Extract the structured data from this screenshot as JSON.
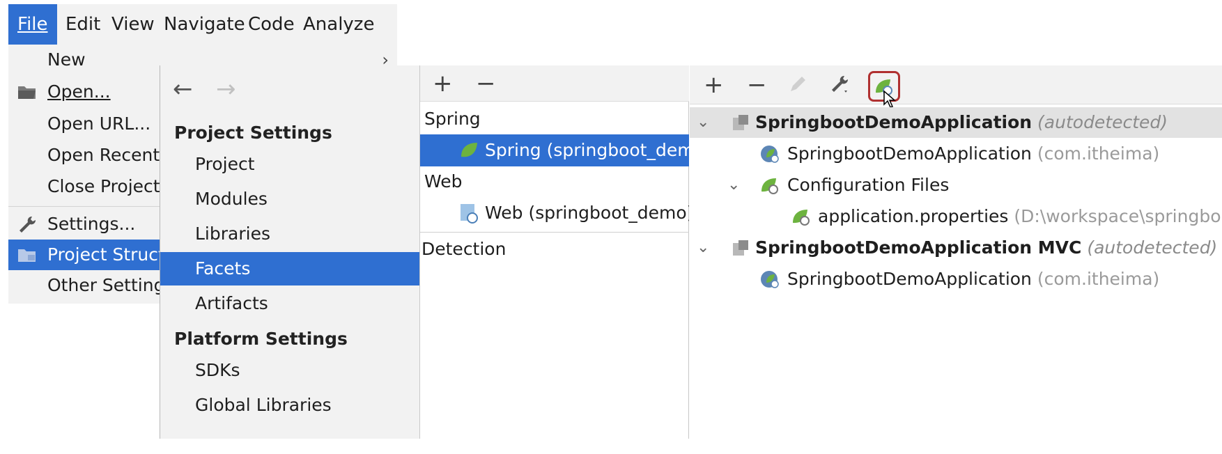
{
  "menubar": {
    "items": [
      "File",
      "Edit",
      "View",
      "Navigate",
      "Code",
      "Analyze"
    ],
    "active": "File"
  },
  "file_menu": {
    "items": [
      {
        "label": "New",
        "icon": "",
        "submenu": true
      },
      {
        "label": "Open...",
        "icon": "folder-icon"
      },
      {
        "label": "Open URL...",
        "icon": ""
      },
      {
        "label": "Open Recent",
        "icon": ""
      },
      {
        "label": "Close Project",
        "icon": ""
      },
      {
        "label": "Settings...",
        "icon": "wrench-icon"
      },
      {
        "label": "Project Struct",
        "icon": "project-structure-icon",
        "active": true
      },
      {
        "label": "Other Setting",
        "icon": ""
      }
    ]
  },
  "dialog": {
    "nav": {
      "back": "←",
      "forward": "→"
    },
    "project_settings": {
      "heading": "Project Settings",
      "items": [
        "Project",
        "Modules",
        "Libraries",
        "Facets",
        "Artifacts"
      ],
      "active": "Facets"
    },
    "platform_settings": {
      "heading": "Platform Settings",
      "items": [
        "SDKs",
        "Global Libraries"
      ]
    },
    "facets": {
      "toolbar": {
        "add": "+",
        "remove": "−"
      },
      "groups": [
        {
          "label": "Spring",
          "child": "Spring (springboot_demo)",
          "child_icon": "spring-leaf-icon",
          "selected": true
        },
        {
          "label": "Web",
          "child": "Web (springboot_demo)",
          "child_icon": "web-icon",
          "selected": false
        }
      ],
      "detection": "Detection"
    },
    "contexts": {
      "toolbar": {
        "add": "+",
        "remove": "−",
        "edit_icon": "pencil-icon",
        "settings_icon": "wrench-icon",
        "dependencies_icon": "spring-dependencies-icon"
      },
      "tree": [
        {
          "name": "SpringbootDemoApplication",
          "suffix": "(autodetected)",
          "icon": "module-icon",
          "bold": true,
          "selected": true,
          "level": 0,
          "expanded": true
        },
        {
          "name": "SpringbootDemoApplication",
          "suffix": "(com.itheima)",
          "icon": "spring-boot-class-icon",
          "level": 1
        },
        {
          "name": "Configuration Files",
          "suffix": "",
          "icon": "spring-config-icon",
          "level": 1,
          "expanded": true
        },
        {
          "name": "application.properties",
          "suffix": "(D:\\workspace\\springbo",
          "icon": "spring-config-icon",
          "level": 2
        },
        {
          "name": "SpringbootDemoApplication MVC",
          "suffix": "(autodetected)",
          "icon": "module-icon",
          "bold": true,
          "level": 0,
          "expanded": true
        },
        {
          "name": "SpringbootDemoApplication",
          "suffix": "(com.itheima)",
          "icon": "spring-boot-class-icon",
          "level": 1
        }
      ]
    }
  },
  "colors": {
    "selection": "#2f6fd1",
    "panel": "#f2f2f2",
    "spring_green": "#6db33f",
    "highlight_border": "#b03030"
  }
}
